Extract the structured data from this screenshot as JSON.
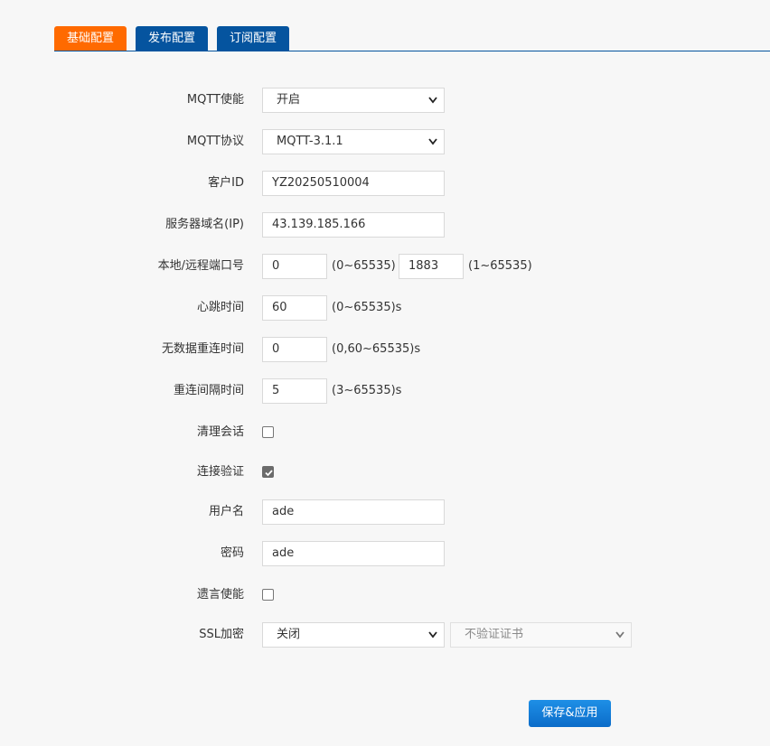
{
  "tabs": [
    {
      "label": "基础配置",
      "active": true
    },
    {
      "label": "发布配置",
      "active": false
    },
    {
      "label": "订阅配置",
      "active": false
    }
  ],
  "colors": {
    "active_tab": "#ff6a00",
    "inactive_tab": "#05549f",
    "save_button": "#0b6cc9"
  },
  "form": {
    "mqtt_enable": {
      "label": "MQTT使能",
      "value": "开启"
    },
    "mqtt_protocol": {
      "label": "MQTT协议",
      "value": "MQTT-3.1.1"
    },
    "client_id": {
      "label": "客户ID",
      "value": "YZ20250510004"
    },
    "server": {
      "label": "服务器域名(IP)",
      "value": "43.139.185.166"
    },
    "ports": {
      "label": "本地/远程端口号",
      "local_value": "0",
      "local_hint": "(0~65535)",
      "remote_value": "1883",
      "remote_hint": "(1~65535)"
    },
    "heartbeat": {
      "label": "心跳时间",
      "value": "60",
      "hint": "(0~65535)s"
    },
    "no_data_reconnect": {
      "label": "无数据重连时间",
      "value": "0",
      "hint": "(0,60~65535)s"
    },
    "reconnect_interval": {
      "label": "重连间隔时间",
      "value": "5",
      "hint": "(3~65535)s"
    },
    "clean_session": {
      "label": "清理会话",
      "checked": false
    },
    "auth": {
      "label": "连接验证",
      "checked": true
    },
    "username": {
      "label": "用户名",
      "value": "ade"
    },
    "password": {
      "label": "密码",
      "value": "ade"
    },
    "will": {
      "label": "遗言使能",
      "checked": false
    },
    "ssl": {
      "label": "SSL加密",
      "value": "关闭",
      "cert_value": "不验证证书"
    }
  },
  "save_label": "保存&应用"
}
